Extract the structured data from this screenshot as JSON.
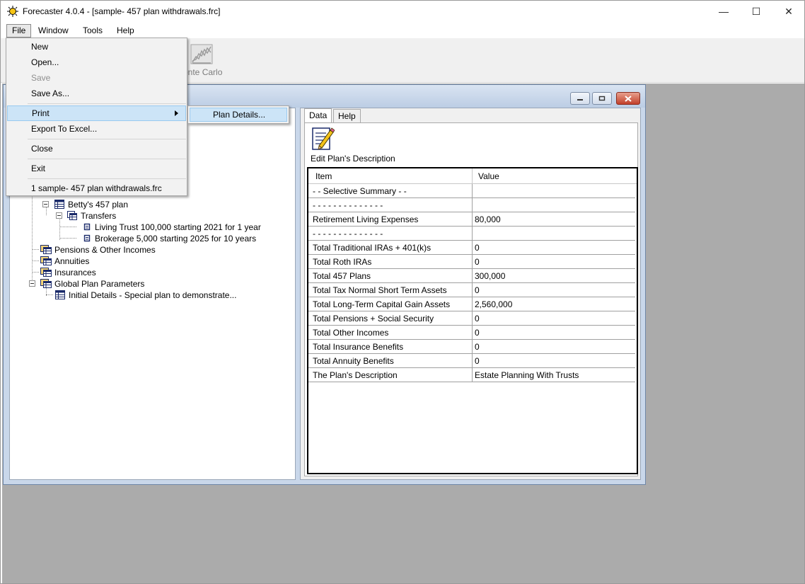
{
  "window": {
    "title": "Forecaster 4.0.4 - [sample- 457 plan withdrawals.frc]",
    "minimize_label": "—",
    "maximize_label": "☐",
    "close_label": "✕"
  },
  "menubar": {
    "file": "File",
    "window": "Window",
    "tools": "Tools",
    "help": "Help"
  },
  "toolbar": {
    "monte_carlo_label": "onte Carlo"
  },
  "file_menu": {
    "new": "New",
    "open": "Open...",
    "save": "Save",
    "save_as": "Save As...",
    "print": "Print",
    "export": "Export To Excel...",
    "close": "Close",
    "exit": "Exit",
    "recent_1": "1 sample- 457 plan withdrawals.frc"
  },
  "print_submenu": {
    "plan_details": "Plan Details..."
  },
  "tree": {
    "bettys_457": "Betty's 457 plan",
    "transfers": "Transfers",
    "living_trust": "Living Trust 100,000 starting 2021 for 1 year",
    "brokerage": "Brokerage 5,000 starting 2025 for 10 years",
    "pensions": "Pensions & Other Incomes",
    "annuities": "Annuities",
    "insurances": "Insurances",
    "global_params": "Global Plan Parameters",
    "initial_details": "Initial Details - Special plan to demonstrate..."
  },
  "tabs": {
    "data": "Data",
    "help": "Help"
  },
  "edit_description_label": "Edit Plan's Description",
  "grid": {
    "columns": {
      "item": "Item",
      "value": "Value"
    },
    "rows": [
      {
        "item": "- - Selective Summary - -",
        "value": ""
      },
      {
        "item": "- - - - - - - - - - - - - -",
        "value": ""
      },
      {
        "item": "Retirement Living Expenses",
        "value": "80,000"
      },
      {
        "item": "- - - - - - - - - - - - - -",
        "value": ""
      },
      {
        "item": "Total Traditional IRAs + 401(k)s",
        "value": "0"
      },
      {
        "item": "Total Roth IRAs",
        "value": "0"
      },
      {
        "item": "Total 457 Plans",
        "value": "300,000"
      },
      {
        "item": "Total Tax Normal Short Term Assets",
        "value": "0"
      },
      {
        "item": "Total Long-Term Capital Gain Assets",
        "value": "2,560,000"
      },
      {
        "item": "Total Pensions + Social Security",
        "value": "0"
      },
      {
        "item": "Total Other Incomes",
        "value": "0"
      },
      {
        "item": "Total Insurance Benefits",
        "value": "0"
      },
      {
        "item": "Total Annuity Benefits",
        "value": "0"
      },
      {
        "item": "The Plan's Description",
        "value": "Estate Planning With Trusts"
      }
    ]
  },
  "colors": {
    "mdi_background": "#ababab",
    "child_frame": "#c9d7ea",
    "menu_highlight": "#cce4f7",
    "close_button_red": "#c2402a"
  },
  "icons": {
    "app": "forecaster-sun-icon",
    "monte_carlo": "monte-carlo-chart-icon",
    "edit_description": "edit-document-pencil-icon",
    "tree_table": "table-icon",
    "tree_folder": "folder-table-icon",
    "tree_item": "item-icon"
  }
}
